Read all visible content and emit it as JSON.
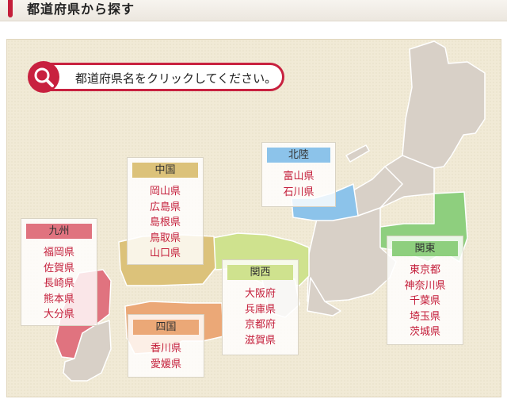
{
  "header": {
    "title": "都道府県から探す",
    "accent": "#c41e3a"
  },
  "prompt": {
    "text": "都道府県名をクリックしてください。",
    "icon": "search-icon"
  },
  "regions": {
    "kyushu": {
      "name": "九州",
      "color": "#e0737f",
      "prefs": [
        "福岡県",
        "佐賀県",
        "長崎県",
        "熊本県",
        "大分県"
      ]
    },
    "chugoku": {
      "name": "中国",
      "color": "#dcc27a",
      "prefs": [
        "岡山県",
        "広島県",
        "島根県",
        "鳥取県",
        "山口県"
      ]
    },
    "hokuriku": {
      "name": "北陸",
      "color": "#8cc3ea",
      "prefs": [
        "富山県",
        "石川県"
      ]
    },
    "kansai": {
      "name": "関西",
      "color": "#cfe28e",
      "prefs": [
        "大阪府",
        "兵庫県",
        "京都府",
        "滋賀県"
      ]
    },
    "shikoku": {
      "name": "四国",
      "color": "#eba877",
      "prefs": [
        "香川県",
        "愛媛県"
      ]
    },
    "kanto": {
      "name": "関東",
      "color": "#8ecf7e",
      "prefs": [
        "東京都",
        "神奈川県",
        "千葉県",
        "埼玉県",
        "茨城県"
      ]
    }
  }
}
